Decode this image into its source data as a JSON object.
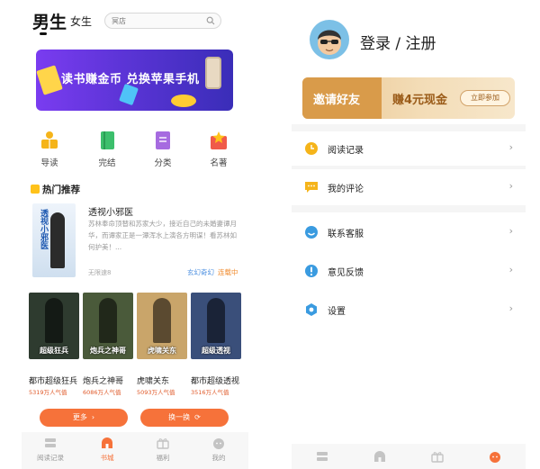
{
  "left": {
    "tabs": {
      "male": "男生",
      "female": "女生"
    },
    "search": {
      "placeholder": "冥店"
    },
    "banner": {
      "text": "读书赚金币 兑换苹果手机"
    },
    "categories": [
      {
        "label": "导读",
        "icon": "reading-guide-icon",
        "color": "#f5b41a"
      },
      {
        "label": "完结",
        "icon": "book-icon",
        "color": "#3cbf6c"
      },
      {
        "label": "分类",
        "icon": "category-icon",
        "color": "#a66be0"
      },
      {
        "label": "名著",
        "icon": "classic-icon",
        "color": "#f05a4a"
      }
    ],
    "hot": {
      "title": "热门推荐"
    },
    "featured": {
      "title": "透视小邪医",
      "cover_text": "透视小邪医",
      "description": "苏林奉命顶替和苏家大少，接近自己的未婚妻谭月华，而谭家正是一潭浑水上演各方明谋！看苏林如何护美！...",
      "author": "无限速8",
      "tags": [
        "玄幻奇幻",
        "连载中"
      ]
    },
    "books": [
      {
        "title": "都市超级狂兵",
        "popularity": "5319万人气值",
        "cover_text": "超级狂兵",
        "color": "#2e3b2f"
      },
      {
        "title": "炮兵之神哥",
        "popularity": "6086万人气值",
        "cover_text": "炮兵之神哥",
        "color": "#4a5a3a"
      },
      {
        "title": "虎啸关东",
        "popularity": "5093万人气值",
        "cover_text": "虎啸关东",
        "color": "#c9a56a"
      },
      {
        "title": "都市超级透视",
        "popularity": "3516万人气值",
        "cover_text": "超级透视",
        "color": "#3a4f7a"
      }
    ],
    "buttons": {
      "more": "更多",
      "refresh": "换一换"
    },
    "nav": [
      {
        "label": "阅读记录",
        "icon": "bookshelf-icon",
        "active": false
      },
      {
        "label": "书城",
        "icon": "bookstore-icon",
        "active": true
      },
      {
        "label": "福利",
        "icon": "gift-icon",
        "active": false
      },
      {
        "label": "我的",
        "icon": "profile-icon",
        "active": false
      }
    ],
    "accent": "#f6723a"
  },
  "right": {
    "login": "登录 / 注册",
    "invite": {
      "title": "邀请好友",
      "reward": "赚4元现金",
      "button": "立即参加"
    },
    "menu": [
      {
        "label": "阅读记录",
        "icon": "clock-icon",
        "color": "#f5b41a"
      },
      {
        "label": "我的评论",
        "icon": "comment-icon",
        "color": "#f5b41a"
      },
      {
        "label": "联系客服",
        "icon": "customer-service-icon",
        "color": "#3a9be0"
      },
      {
        "label": "意见反馈",
        "icon": "feedback-icon",
        "color": "#3a9be0"
      },
      {
        "label": "设置",
        "icon": "settings-icon",
        "color": "#3a9be0"
      }
    ],
    "arrow": "›"
  }
}
